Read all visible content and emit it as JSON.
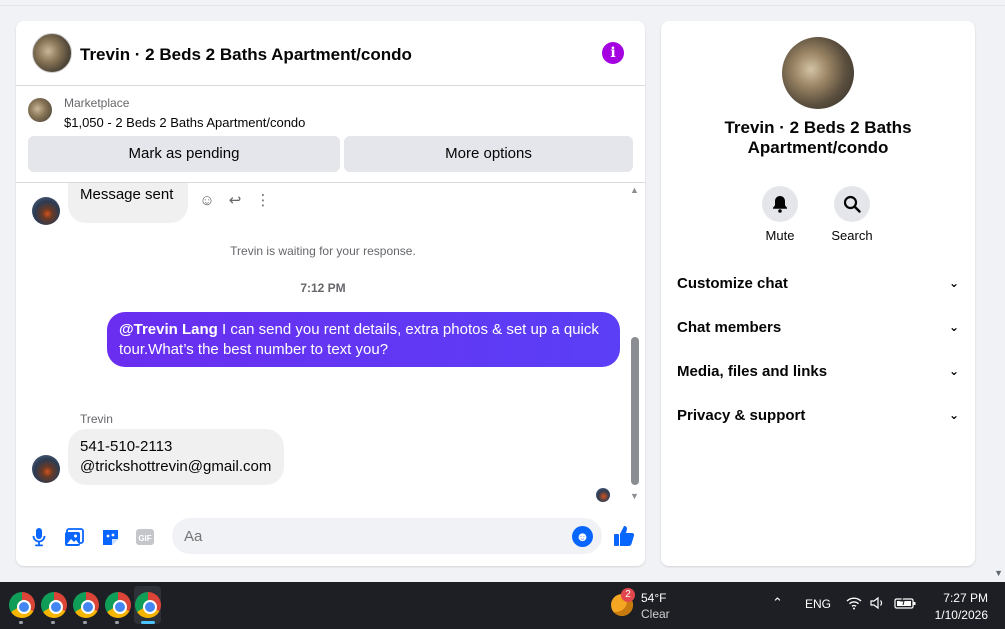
{
  "header": {
    "title": "Trevin · 2 Beds 2 Baths Apartment/condo",
    "info_icon": "info-icon"
  },
  "listing": {
    "kicker": "Marketplace",
    "price_line": "$1,050 - 2 Beds 2 Baths Apartment/condo",
    "mark_pending_label": "Mark as pending",
    "more_options_label": "More options"
  },
  "messages": {
    "sent_text": "Message sent",
    "waiting_text": "Trevin is waiting for your response.",
    "timestamp": "7:12 PM",
    "outgoing_mention": "@Trevin Lang",
    "outgoing_text": " I can send you rent details, extra photos & set up a quick tour.What’s the best number to text you?",
    "sender_name": "Trevin",
    "contact_line1": "541-510-2113",
    "contact_line2": "@trickshottrevin@gmail.com"
  },
  "composer": {
    "placeholder": "Aa"
  },
  "details": {
    "title": "Trevin · 2 Beds 2 Baths Apartment/condo",
    "mute_label": "Mute",
    "search_label": "Search",
    "sections": [
      {
        "label": "Customize chat"
      },
      {
        "label": "Chat members"
      },
      {
        "label": "Media, files and links"
      },
      {
        "label": "Privacy & support"
      }
    ]
  },
  "taskbar": {
    "weather_badge": "2",
    "temperature": "54°F",
    "condition": "Clear",
    "language": "ENG",
    "time": "7:27 PM",
    "date": "1/10/2026"
  },
  "colors": {
    "accent": "#0866ff",
    "outgoing_bubble": "#5f36f5",
    "info_icon": "#a400e0"
  }
}
